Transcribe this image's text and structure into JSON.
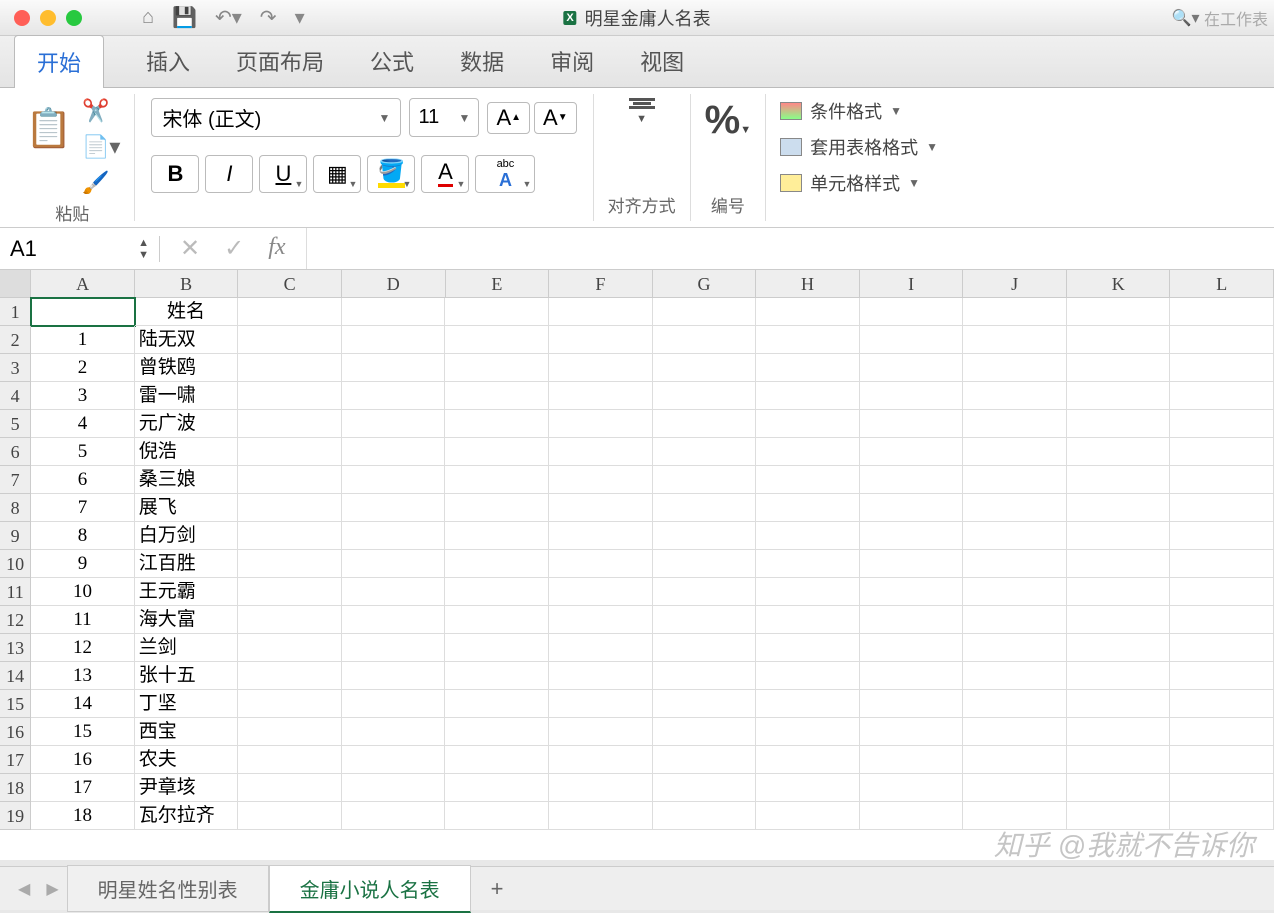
{
  "title": "明星金庸人名表",
  "search_placeholder": "在工作表",
  "tabs": {
    "start": "开始",
    "insert": "插入",
    "layout": "页面布局",
    "formula": "公式",
    "data": "数据",
    "review": "审阅",
    "view": "视图"
  },
  "ribbon": {
    "paste": "粘贴",
    "font_name": "宋体 (正文)",
    "font_size": "11",
    "align": "对齐方式",
    "number": "编号",
    "cond_fmt": "条件格式",
    "table_fmt": "套用表格格式",
    "cell_style": "单元格样式"
  },
  "namebox": "A1",
  "columns": [
    "A",
    "B",
    "C",
    "D",
    "E",
    "F",
    "G",
    "H",
    "I",
    "J",
    "K",
    "L"
  ],
  "header_row": {
    "A": "",
    "B": "姓名"
  },
  "rows": [
    {
      "n": "1",
      "name": "陆无双"
    },
    {
      "n": "2",
      "name": "曾铁鸥"
    },
    {
      "n": "3",
      "name": "雷一啸"
    },
    {
      "n": "4",
      "name": "元广波"
    },
    {
      "n": "5",
      "name": "倪浩"
    },
    {
      "n": "6",
      "name": "桑三娘"
    },
    {
      "n": "7",
      "name": "展飞"
    },
    {
      "n": "8",
      "name": "白万剑"
    },
    {
      "n": "9",
      "name": "江百胜"
    },
    {
      "n": "10",
      "name": "王元霸"
    },
    {
      "n": "11",
      "name": "海大富"
    },
    {
      "n": "12",
      "name": "兰剑"
    },
    {
      "n": "13",
      "name": "张十五"
    },
    {
      "n": "14",
      "name": "丁坚"
    },
    {
      "n": "15",
      "name": "西宝"
    },
    {
      "n": "16",
      "name": "农夫"
    },
    {
      "n": "17",
      "name": "尹章垓"
    },
    {
      "n": "18",
      "name": "瓦尔拉齐"
    }
  ],
  "sheets": {
    "s1": "明星姓名性别表",
    "s2": "金庸小说人名表"
  },
  "watermark": "知乎 @我就不告诉你"
}
